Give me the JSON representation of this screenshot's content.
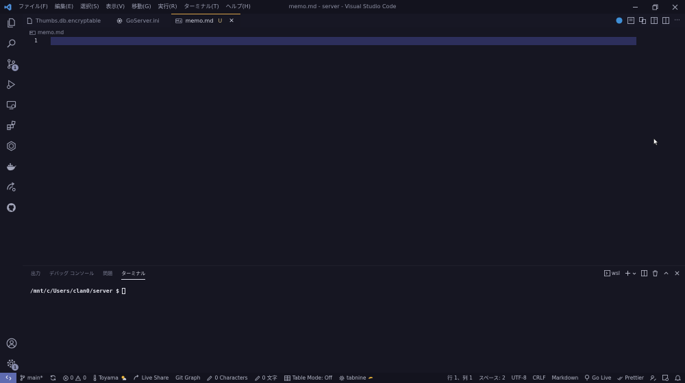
{
  "window": {
    "title": "memo.md - server - Visual Studio Code",
    "menu": [
      "ファイル(F)",
      "編集(E)",
      "選択(S)",
      "表示(V)",
      "移動(G)",
      "実行(R)",
      "ターミナル(T)",
      "ヘルプ(H)"
    ]
  },
  "activity_bar": {
    "icons": [
      "files-icon",
      "search-icon",
      "source-control-icon",
      "run-debug-icon",
      "remote-explorer-icon",
      "extensions-icon",
      "kubernetes-icon",
      "docker-icon",
      "live-share-icon",
      "github-icon",
      "accounts-icon",
      "settings-icon"
    ],
    "badges": {
      "source_control": "1",
      "settings": "1"
    }
  },
  "tabs": [
    {
      "label": "Thumbs.db.encryptable",
      "icon": "file-icon",
      "active": false
    },
    {
      "label": "GoServer.ini",
      "icon": "gear-icon",
      "active": false
    },
    {
      "label": "memo.md",
      "status": "U",
      "icon": "markdown-icon",
      "active": true
    }
  ],
  "breadcrumb": {
    "file": "memo.md"
  },
  "editor": {
    "line_numbers": [
      "1"
    ]
  },
  "panel": {
    "tabs": [
      "出力",
      "デバッグ コンソール",
      "問題",
      "ターミナル"
    ],
    "active_tab": "ターミナル",
    "terminal_profile": "wsl",
    "prompt": "/mnt/c/Users/clan0/server $"
  },
  "statusbar": {
    "branch": "main*",
    "errors": "0",
    "warnings": "0",
    "location": "Toyama",
    "live_share": "Live Share",
    "git_graph": "Git Graph",
    "characters": "0 Characters",
    "chars_jp": "0 文字",
    "table_mode": "Table Mode: Off",
    "tabnine": "tabnine",
    "cursor_position": "行 1、列 1",
    "spaces": "スペース: 2",
    "encoding": "UTF-8",
    "eol": "CRLF",
    "language": "Markdown",
    "go_live": "Go Live",
    "prettier": "Prettier"
  },
  "colors": {
    "background": "#161622",
    "current_line": "#2d2f5c",
    "active_tab_border": "#d9a34a",
    "remote_indicator": "#5e6bb0"
  }
}
